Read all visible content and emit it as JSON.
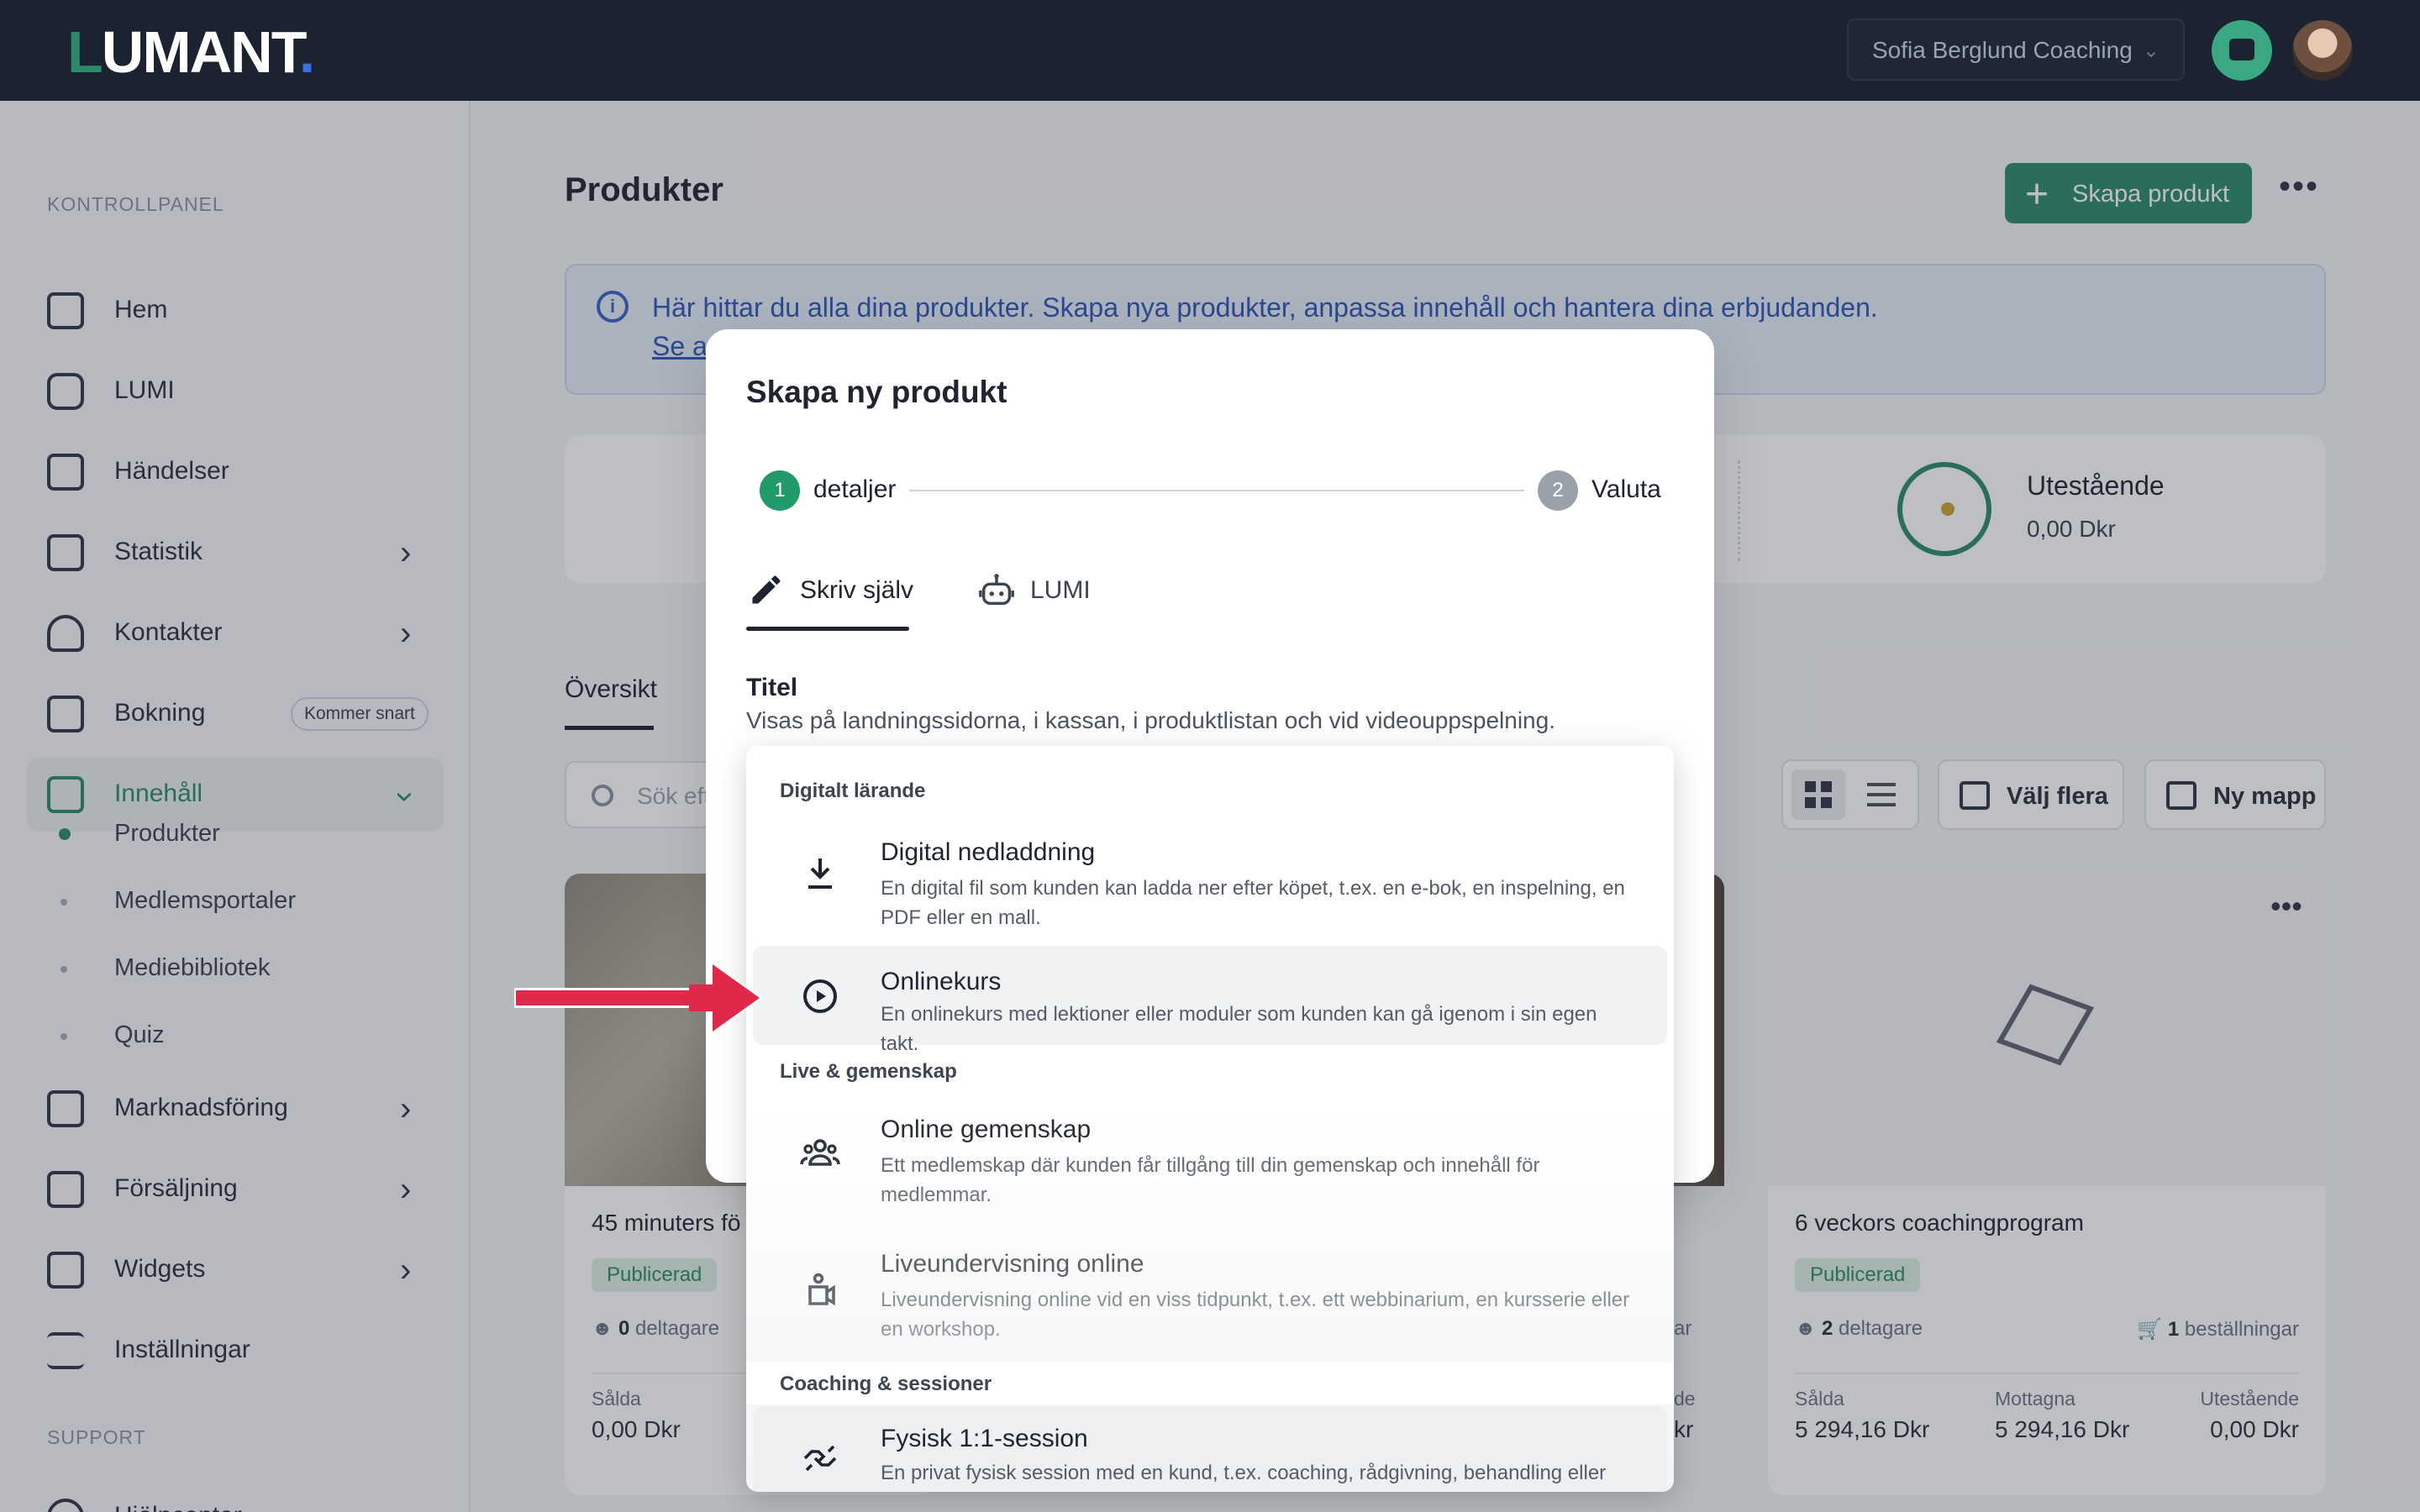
{
  "topbar": {
    "logo": "LUMANT",
    "logo_first": "L",
    "logo_rest": "UMANT",
    "logo_dot": ".",
    "org_name": "Sofia Berglund Coaching",
    "icons": [
      "chevron-down-icon",
      "chat-icon",
      "avatar"
    ]
  },
  "sidebar": {
    "section_main": "KONTROLLPANEL",
    "section_support": "SUPPORT",
    "items": [
      {
        "label": "Hem",
        "icon": "monitor-icon"
      },
      {
        "label": "LUMI",
        "icon": "robot-icon"
      },
      {
        "label": "Händelser",
        "icon": "calendar-star-icon"
      },
      {
        "label": "Statistik",
        "icon": "chart-icon"
      },
      {
        "label": "Kontakter",
        "icon": "user-icon"
      },
      {
        "label": "Bokning",
        "icon": "calendar-clock-icon",
        "badge": "Kommer snart"
      },
      {
        "label": "Innehåll",
        "icon": "play-icon"
      },
      {
        "label": "Marknadsföring",
        "icon": "megaphone-icon"
      },
      {
        "label": "Försäljning",
        "icon": "cash-icon"
      },
      {
        "label": "Widgets",
        "icon": "widgets-icon"
      },
      {
        "label": "Inställningar",
        "icon": "sliders-icon"
      },
      {
        "label": "Hjälpcenter",
        "icon": "help-icon"
      }
    ],
    "sub_items": [
      "Produkter",
      "Medlemsportaler",
      "Mediebibliotek",
      "Quiz"
    ]
  },
  "main": {
    "title": "Produkter",
    "create_button": "Skapa produkt",
    "info_text": "Här hittar du alla dina produkter. Skapa nya produkter, anpassa innehåll och hantera dina erbjudanden.",
    "info_link": "Se a",
    "stats": {
      "label": "Utestående",
      "value": "0,00 Dkr"
    },
    "tab": "Översikt",
    "search_placeholder": "Sök eft",
    "select_multiple": "Välj flera",
    "new_folder": "Ny mapp",
    "cards": [
      {
        "title": "45 minuters fö",
        "status": "Publicerad",
        "participants_count": "0",
        "participants_label": "deltagare",
        "sold_label": "Sålda",
        "sold_value": "0,00 Dkr"
      },
      {
        "title": "6 veckors coachingprogram",
        "status": "Publicerad",
        "participants_count": "2",
        "participants_label": "deltagare",
        "orders_count": "1",
        "orders_label": "beställningar",
        "sold_label": "Sålda",
        "sold_value": "5 294,16 Dkr",
        "received_label": "Mottagna",
        "received_value": "5 294,16 Dkr",
        "outstanding_label": "Utestående",
        "outstanding_value": "0,00 Dkr"
      }
    ],
    "partial_texts": {
      "edge_ar": "ar",
      "edge_de": "de",
      "edge_kr": "kr"
    }
  },
  "modal": {
    "title": "Skapa ny produkt",
    "steps": [
      {
        "number": "1",
        "label": "detaljer"
      },
      {
        "number": "2",
        "label": "Valuta"
      }
    ],
    "tabs": [
      {
        "label": "Skriv själv",
        "icon": "pencil-icon"
      },
      {
        "label": "LUMI",
        "icon": "robot-icon"
      }
    ],
    "field_label": "Titel",
    "field_help": "Visas på landningssidorna, i kassan, i produktlistan och vid videouppspelning."
  },
  "dropdown": {
    "groups": [
      {
        "label": "Digitalt lärande",
        "items": [
          {
            "title": "Digital nedladdning",
            "desc": "En digital fil som kunden kan ladda ner efter köpet, t.ex. en e-bok, en inspelning, en PDF eller en mall.",
            "icon": "download-icon"
          },
          {
            "title": "Onlinekurs",
            "desc": "En onlinekurs med lektioner eller moduler som kunden kan gå igenom i sin egen takt.",
            "icon": "play-circle-icon"
          }
        ]
      },
      {
        "label": "Live & gemenskap",
        "items": [
          {
            "title": "Online gemenskap",
            "desc": "Ett medlemskap där kunden får tillgång till din gemenskap och innehåll för medlemmar.",
            "icon": "community-icon"
          },
          {
            "title": "Liveundervisning online",
            "desc": "Liveundervisning online vid en viss tidpunkt, t.ex. ett webbinarium, en kursserie eller en workshop.",
            "icon": "live-video-icon"
          }
        ]
      },
      {
        "label": "Coaching & sessioner",
        "items": [
          {
            "title": "Fysisk 1:1-session",
            "desc": "En privat fysisk session med en kund, t.ex. coaching, rådgivning, behandling eller",
            "icon": "handshake-icon"
          }
        ]
      }
    ]
  },
  "colors": {
    "brand_green": "#2c8a6b",
    "topbar": "#1b2230",
    "info_blue": "#2f55b5",
    "arrow_red": "#e0284a",
    "step_inactive": "#9aa1ab"
  }
}
